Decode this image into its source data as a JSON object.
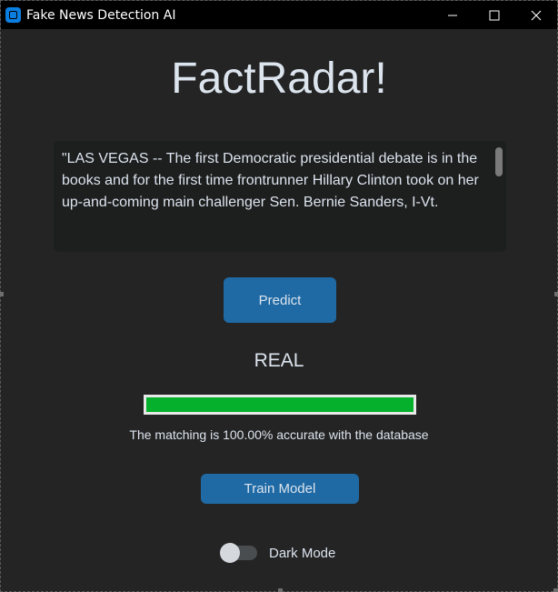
{
  "window": {
    "title": "Fake News Detection AI",
    "controls": [
      "minimize-icon",
      "maximize-icon",
      "close-icon"
    ]
  },
  "main": {
    "heading": "FactRadar!",
    "article_text": "\"LAS VEGAS -- The first Democratic presidential debate is in the books and for the first time frontrunner Hillary Clinton took on her up-and-coming main challenger Sen. Bernie Sanders, I-Vt.",
    "predict_label": "Predict",
    "result": "REAL",
    "confidence_fraction": 1.0,
    "accuracy_text": "The matching is 100.00% accurate with the database",
    "train_label": "Train Model",
    "dark_mode_label": "Dark Mode",
    "dark_mode_on": false
  },
  "colors": {
    "window_bg": "#242424",
    "titlebar_bg": "#000000",
    "accent_button": "#1f6aa5",
    "progress_fill": "#04b02c",
    "text": "#dce4ee"
  }
}
